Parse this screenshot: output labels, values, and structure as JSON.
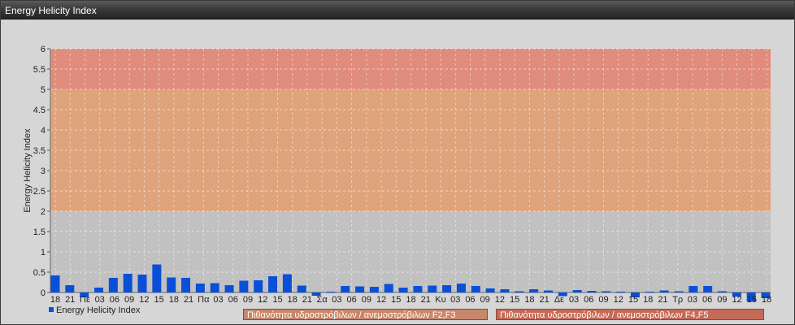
{
  "window": {
    "title": "Energy Helicity Index"
  },
  "legend": {
    "series_label": "Energy Helicity Index",
    "series_color": "#0a4fd8"
  },
  "probability_boxes": [
    {
      "label": "Πιθανότητα υδροστρόβιλων / ανεμοστρόβιλων F2,F3",
      "color": "#c8866a"
    },
    {
      "label": "Πιθανότητα υδροστρόβιλων / ανεμοστρόβιλων F4,F5",
      "color": "#c66a58"
    }
  ],
  "chart_data": {
    "type": "bar",
    "ylabel": "Energy Helicity Index",
    "ylim": [
      0,
      6
    ],
    "yticks": [
      "0",
      "0.5",
      "1",
      "1.5",
      "2",
      "2.5",
      "3",
      "3.5",
      "4",
      "4.5",
      "5",
      "5.5",
      "6"
    ],
    "grid": true,
    "bands": [
      {
        "from": 0,
        "to": 2,
        "color": "#c0c0c0"
      },
      {
        "from": 2,
        "to": 5,
        "color": "#dea27a"
      },
      {
        "from": 5,
        "to": 6,
        "color": "#df8a7a"
      }
    ],
    "categories": [
      "18",
      "21",
      "Πε",
      "03",
      "06",
      "09",
      "12",
      "15",
      "18",
      "21",
      "Πα",
      "03",
      "06",
      "09",
      "12",
      "15",
      "18",
      "21",
      "Σα",
      "03",
      "06",
      "09",
      "12",
      "15",
      "18",
      "21",
      "Κυ",
      "03",
      "06",
      "09",
      "12",
      "15",
      "18",
      "21",
      "Δε",
      "03",
      "06",
      "09",
      "12",
      "15",
      "18",
      "21",
      "Τρ",
      "03",
      "06",
      "09",
      "12",
      "15",
      "18"
    ],
    "series": [
      {
        "name": "Energy Helicity Index",
        "color": "#0a4fd8",
        "values": [
          0.42,
          0.18,
          -0.12,
          0.12,
          0.36,
          0.46,
          0.44,
          0.69,
          0.37,
          0.36,
          0.22,
          0.23,
          0.18,
          0.29,
          0.3,
          0.4,
          0.45,
          0.17,
          -0.08,
          0.02,
          0.16,
          0.15,
          0.14,
          0.21,
          0.12,
          0.16,
          0.17,
          0.18,
          0.22,
          0.16,
          0.1,
          0.08,
          0.03,
          0.08,
          0.05,
          -0.09,
          0.06,
          0.04,
          0.03,
          0.02,
          -0.12,
          0.02,
          0.05,
          0.03,
          0.16,
          0.16,
          0.03,
          -0.1,
          -0.22,
          -0.14
        ]
      }
    ]
  }
}
